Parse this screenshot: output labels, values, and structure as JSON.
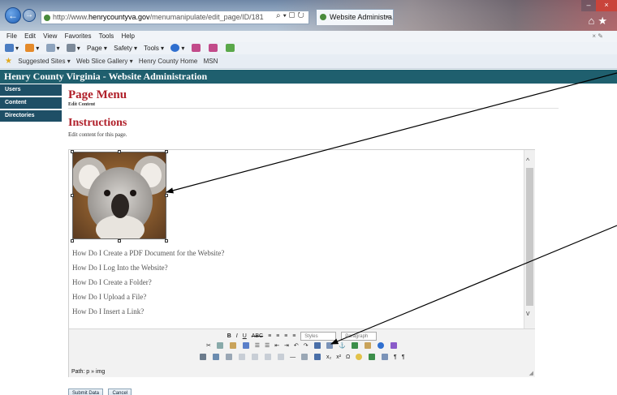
{
  "browser": {
    "address_prefix": "http://www.",
    "address_domain": "henrycountyva.gov",
    "address_path": "/menumanipulate/edit_page/ID/181",
    "tab_title": "Website Administra...",
    "menu": [
      "File",
      "Edit",
      "View",
      "Favorites",
      "Tools",
      "Help"
    ],
    "command_items": [
      "Page ▾",
      "Safety ▾",
      "Tools ▾"
    ],
    "favorites": [
      "Suggested Sites ▾",
      "Web Slice Gallery ▾",
      "Henry County Home",
      "MSN"
    ]
  },
  "site": {
    "header_title": "Henry County Virginia - Website Administration",
    "nav": [
      "Users",
      "Content",
      "Directories"
    ]
  },
  "page": {
    "title": "Page Menu",
    "subtitle": "Edit Content",
    "section_title": "Instructions",
    "section_desc": "Edit content for this page."
  },
  "editor": {
    "links": [
      "How Do I Create a PDF Document for the Website?",
      "How Do I Log Into the Website?",
      "How Do I Create a Folder?",
      "How Do I Upload a File?",
      "How Do I Insert a Link?"
    ],
    "styles_label": "Styles",
    "paragraph_label": "Paragraph",
    "path_text": "Path: p » img",
    "image_icon": "koala-image"
  },
  "actions": {
    "submit_label": "Submit Data",
    "cancel_label": "Cancel"
  },
  "colors": {
    "header_bg": "#1f5f6e",
    "nav_bg": "#1e4f66",
    "title_red": "#b0202a"
  }
}
